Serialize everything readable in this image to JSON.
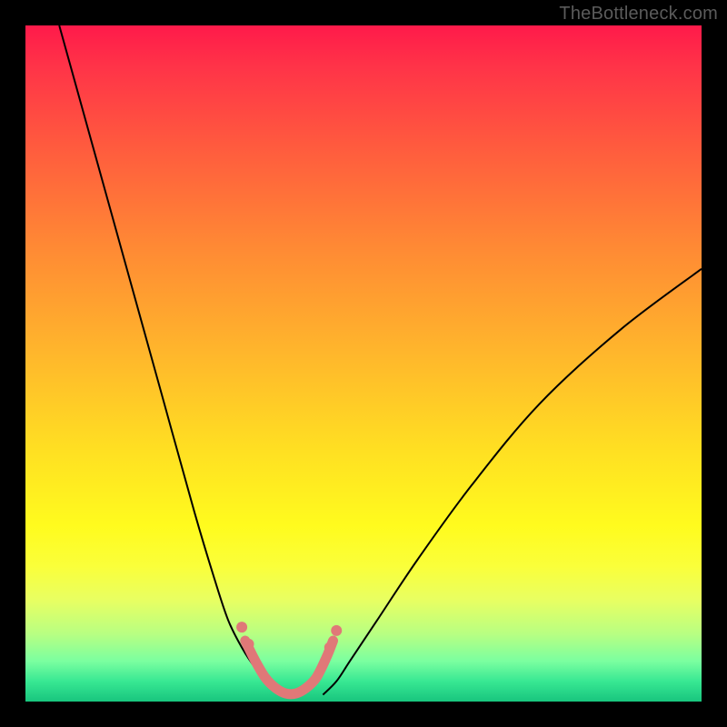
{
  "watermark": "TheBottleneck.com",
  "chart_data": {
    "type": "line",
    "title": "",
    "xlabel": "",
    "ylabel": "",
    "xlim": [
      0,
      100
    ],
    "ylim": [
      0,
      100
    ],
    "grid": false,
    "series": [
      {
        "name": "left-branch",
        "stroke": "#000000",
        "stroke_width": 2,
        "x": [
          5,
          10,
          15,
          20,
          25,
          28,
          30,
          32,
          34,
          36,
          38,
          39
        ],
        "y": [
          100,
          82,
          64,
          46,
          28,
          18,
          12,
          8,
          5,
          3,
          1.5,
          1
        ]
      },
      {
        "name": "right-branch",
        "stroke": "#000000",
        "stroke_width": 2,
        "x": [
          44,
          46,
          48,
          52,
          58,
          66,
          76,
          88,
          100
        ],
        "y": [
          1,
          3,
          6,
          12,
          21,
          32,
          44,
          55,
          64
        ]
      },
      {
        "name": "bottom-marker-trail",
        "stroke": "#e07878",
        "stroke_width": 11,
        "linecap": "round",
        "x": [
          32.5,
          34,
          35.5,
          37,
          38.5,
          40,
          41.5,
          43,
          44.5,
          45.5
        ],
        "y": [
          9,
          6,
          3.5,
          2,
          1.2,
          1.2,
          2,
          3.5,
          6.5,
          9
        ]
      }
    ],
    "markers": [
      {
        "name": "left-upper-dot",
        "x": 32.0,
        "y": 11.0,
        "r": 6,
        "fill": "#e07878"
      },
      {
        "name": "left-lower-dot",
        "x": 33.0,
        "y": 8.5,
        "r": 6,
        "fill": "#e07878"
      },
      {
        "name": "right-lower-dot",
        "x": 45.0,
        "y": 8.0,
        "r": 6,
        "fill": "#e07878"
      },
      {
        "name": "right-upper-dot",
        "x": 46.0,
        "y": 10.5,
        "r": 6,
        "fill": "#e07878"
      }
    ]
  }
}
